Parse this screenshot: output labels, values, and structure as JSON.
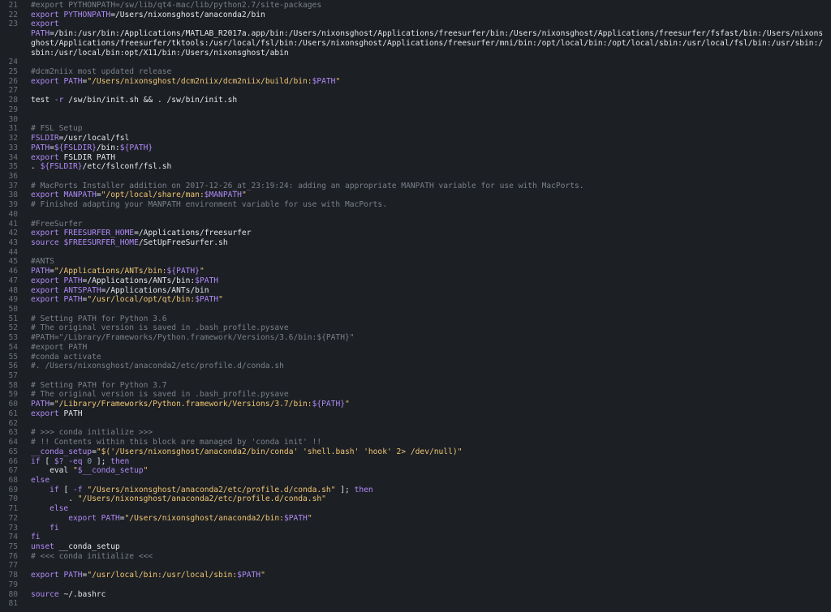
{
  "colors": {
    "background": "#1c1f24",
    "line_number": "#6b717a",
    "comment": "#7b8089",
    "keyword": "#b08bf7",
    "string": "#f0c674",
    "text": "#e4e6ea"
  },
  "lines": [
    {
      "n": "21",
      "tokens": [
        {
          "t": "cm",
          "v": "#export PYTHONPATH=/sw/lib/qt4-mac/lib/python2.7/site-packages"
        }
      ]
    },
    {
      "n": "22",
      "tokens": [
        {
          "t": "kw",
          "v": "export "
        },
        {
          "t": "vr",
          "v": "PYTHONPATH"
        },
        {
          "t": "tx",
          "v": "=/Users/nixonsghost/anaconda2/bin"
        }
      ]
    },
    {
      "n": "23",
      "tokens": [
        {
          "t": "kw",
          "v": "export\n"
        },
        {
          "t": "vr",
          "v": "PATH"
        },
        {
          "t": "tx",
          "v": "=/bin:/usr/bin:/Applications/MATLAB_R2017a.app/bin:/Users/nixonsghost/Applications/freesurfer/bin:/Users/nixonsghost/Applications/freesurfer/fsfast/bin:/Users/nixonsghost/Applications/freesurfer/tktools:/usr/local/fsl/bin:/Users/nixonsghost/Applications/freesurfer/mni/bin:/opt/local/bin:/opt/local/sbin:/usr/local/fsl/bin:/usr/sbin:/sbin:/usr/local/bin:opt/X11/bin:/Users/nixonsghost/abin"
        }
      ]
    },
    {
      "n": "24",
      "tokens": []
    },
    {
      "n": "25",
      "tokens": [
        {
          "t": "cm",
          "v": "#dcm2niix most updated release"
        }
      ]
    },
    {
      "n": "26",
      "tokens": [
        {
          "t": "kw",
          "v": "export "
        },
        {
          "t": "vr",
          "v": "PATH"
        },
        {
          "t": "tx",
          "v": "="
        },
        {
          "t": "st",
          "v": "\"/Users/nixonsghost/dcm2niix/dcm2niix/build/bin:"
        },
        {
          "t": "vr",
          "v": "$PATH"
        },
        {
          "t": "st",
          "v": "\""
        }
      ]
    },
    {
      "n": "27",
      "tokens": []
    },
    {
      "n": "28",
      "tokens": [
        {
          "t": "tx",
          "v": "test "
        },
        {
          "t": "kw",
          "v": "-r"
        },
        {
          "t": "tx",
          "v": " /sw/bin/init.sh && . /sw/bin/init.sh"
        }
      ]
    },
    {
      "n": "29",
      "tokens": []
    },
    {
      "n": "30",
      "tokens": []
    },
    {
      "n": "31",
      "tokens": [
        {
          "t": "cm",
          "v": "# FSL Setup"
        }
      ]
    },
    {
      "n": "32",
      "tokens": [
        {
          "t": "vr",
          "v": "FSLDIR"
        },
        {
          "t": "tx",
          "v": "=/usr/local/fsl"
        }
      ]
    },
    {
      "n": "33",
      "tokens": [
        {
          "t": "vr",
          "v": "PATH"
        },
        {
          "t": "tx",
          "v": "="
        },
        {
          "t": "vr",
          "v": "${FSLDIR}"
        },
        {
          "t": "tx",
          "v": "/bin:"
        },
        {
          "t": "vr",
          "v": "${PATH}"
        }
      ]
    },
    {
      "n": "34",
      "tokens": [
        {
          "t": "kw",
          "v": "export "
        },
        {
          "t": "tx",
          "v": "FSLDIR PATH"
        }
      ]
    },
    {
      "n": "35",
      "tokens": [
        {
          "t": "tx",
          "v": ". "
        },
        {
          "t": "vr",
          "v": "${FSLDIR}"
        },
        {
          "t": "tx",
          "v": "/etc/fslconf/fsl.sh"
        }
      ]
    },
    {
      "n": "36",
      "tokens": []
    },
    {
      "n": "37",
      "tokens": [
        {
          "t": "cm",
          "v": "# MacPorts Installer addition on 2017-12-26_at_23:19:24: adding an appropriate MANPATH variable for use with MacPorts."
        }
      ]
    },
    {
      "n": "38",
      "tokens": [
        {
          "t": "kw",
          "v": "export "
        },
        {
          "t": "vr",
          "v": "MANPATH"
        },
        {
          "t": "tx",
          "v": "="
        },
        {
          "t": "st",
          "v": "\"/opt/local/share/man:"
        },
        {
          "t": "vr",
          "v": "$MANPATH"
        },
        {
          "t": "st",
          "v": "\""
        }
      ]
    },
    {
      "n": "39",
      "tokens": [
        {
          "t": "cm",
          "v": "# Finished adapting your MANPATH environment variable for use with MacPorts."
        }
      ]
    },
    {
      "n": "40",
      "tokens": []
    },
    {
      "n": "41",
      "tokens": [
        {
          "t": "cm",
          "v": "#FreeSurfer"
        }
      ]
    },
    {
      "n": "42",
      "tokens": [
        {
          "t": "kw",
          "v": "export "
        },
        {
          "t": "vr",
          "v": "FREESURFER_HOME"
        },
        {
          "t": "tx",
          "v": "=/Applications/freesurfer"
        }
      ]
    },
    {
      "n": "43",
      "tokens": [
        {
          "t": "kw",
          "v": "source "
        },
        {
          "t": "vr",
          "v": "$FREESURFER_HOME"
        },
        {
          "t": "tx",
          "v": "/SetUpFreeSurfer.sh"
        }
      ]
    },
    {
      "n": "44",
      "tokens": []
    },
    {
      "n": "45",
      "tokens": [
        {
          "t": "cm",
          "v": "#ANTS"
        }
      ]
    },
    {
      "n": "46",
      "tokens": [
        {
          "t": "vr",
          "v": "PATH"
        },
        {
          "t": "tx",
          "v": "="
        },
        {
          "t": "st",
          "v": "\"/Applications/ANTs/bin:"
        },
        {
          "t": "vr",
          "v": "${PATH}"
        },
        {
          "t": "st",
          "v": "\""
        }
      ]
    },
    {
      "n": "47",
      "tokens": [
        {
          "t": "kw",
          "v": "export "
        },
        {
          "t": "vr",
          "v": "PATH"
        },
        {
          "t": "tx",
          "v": "=/Applications/ANTs/bin:"
        },
        {
          "t": "vr",
          "v": "$PATH"
        }
      ]
    },
    {
      "n": "48",
      "tokens": [
        {
          "t": "kw",
          "v": "export "
        },
        {
          "t": "vr",
          "v": "ANTSPATH"
        },
        {
          "t": "tx",
          "v": "=/Applications/ANTs/bin"
        }
      ]
    },
    {
      "n": "49",
      "tokens": [
        {
          "t": "kw",
          "v": "export "
        },
        {
          "t": "vr",
          "v": "PATH"
        },
        {
          "t": "tx",
          "v": "="
        },
        {
          "t": "st",
          "v": "\"/usr/local/opt/qt/bin:"
        },
        {
          "t": "vr",
          "v": "$PATH"
        },
        {
          "t": "st",
          "v": "\""
        }
      ]
    },
    {
      "n": "50",
      "tokens": []
    },
    {
      "n": "51",
      "tokens": [
        {
          "t": "cm",
          "v": "# Setting PATH for Python 3.6"
        }
      ]
    },
    {
      "n": "52",
      "tokens": [
        {
          "t": "cm",
          "v": "# The original version is saved in .bash_profile.pysave"
        }
      ]
    },
    {
      "n": "53",
      "tokens": [
        {
          "t": "cm",
          "v": "#PATH=\"/Library/Frameworks/Python.framework/Versions/3.6/bin:${PATH}\""
        }
      ]
    },
    {
      "n": "54",
      "tokens": [
        {
          "t": "cm",
          "v": "#export PATH"
        }
      ]
    },
    {
      "n": "55",
      "tokens": [
        {
          "t": "cm",
          "v": "#conda activate"
        }
      ]
    },
    {
      "n": "56",
      "tokens": [
        {
          "t": "cm",
          "v": "#. /Users/nixonsghost/anaconda2/etc/profile.d/conda.sh"
        }
      ]
    },
    {
      "n": "57",
      "tokens": []
    },
    {
      "n": "58",
      "tokens": [
        {
          "t": "cm",
          "v": "# Setting PATH for Python 3.7"
        }
      ]
    },
    {
      "n": "59",
      "tokens": [
        {
          "t": "cm",
          "v": "# The original version is saved in .bash_profile.pysave"
        }
      ]
    },
    {
      "n": "60",
      "tokens": [
        {
          "t": "vr",
          "v": "PATH"
        },
        {
          "t": "tx",
          "v": "="
        },
        {
          "t": "st",
          "v": "\"/Library/Frameworks/Python.framework/Versions/3.7/bin:"
        },
        {
          "t": "vr",
          "v": "${PATH}"
        },
        {
          "t": "st",
          "v": "\""
        }
      ]
    },
    {
      "n": "61",
      "tokens": [
        {
          "t": "kw",
          "v": "export "
        },
        {
          "t": "tx",
          "v": "PATH"
        }
      ]
    },
    {
      "n": "62",
      "tokens": []
    },
    {
      "n": "63",
      "tokens": [
        {
          "t": "cm",
          "v": "# >>> conda initialize >>>"
        }
      ]
    },
    {
      "n": "64",
      "tokens": [
        {
          "t": "cm",
          "v": "# !! Contents within this block are managed by 'conda init' !!"
        }
      ]
    },
    {
      "n": "65",
      "tokens": [
        {
          "t": "vr",
          "v": "__conda_setup"
        },
        {
          "t": "tx",
          "v": "="
        },
        {
          "t": "st",
          "v": "\"$('/Users/nixonsghost/anaconda2/bin/conda' 'shell.bash' 'hook' 2> /dev/null)\""
        }
      ]
    },
    {
      "n": "66",
      "tokens": [
        {
          "t": "kw",
          "v": "if"
        },
        {
          "t": "tx",
          "v": " [ "
        },
        {
          "t": "vr",
          "v": "$?"
        },
        {
          "t": "tx",
          "v": " "
        },
        {
          "t": "kw",
          "v": "-eq"
        },
        {
          "t": "tx",
          "v": " "
        },
        {
          "t": "nu",
          "v": "0"
        },
        {
          "t": "tx",
          "v": " ]; "
        },
        {
          "t": "kw",
          "v": "then"
        }
      ]
    },
    {
      "n": "67",
      "tokens": [
        {
          "t": "tx",
          "v": "    eval "
        },
        {
          "t": "st",
          "v": "\""
        },
        {
          "t": "vr",
          "v": "$__conda_setup"
        },
        {
          "t": "st",
          "v": "\""
        }
      ]
    },
    {
      "n": "68",
      "tokens": [
        {
          "t": "kw",
          "v": "else"
        }
      ]
    },
    {
      "n": "69",
      "tokens": [
        {
          "t": "tx",
          "v": "    "
        },
        {
          "t": "kw",
          "v": "if"
        },
        {
          "t": "tx",
          "v": " [ "
        },
        {
          "t": "kw",
          "v": "-f"
        },
        {
          "t": "tx",
          "v": " "
        },
        {
          "t": "st",
          "v": "\"/Users/nixonsghost/anaconda2/etc/profile.d/conda.sh\""
        },
        {
          "t": "tx",
          "v": " ]; "
        },
        {
          "t": "kw",
          "v": "then"
        }
      ]
    },
    {
      "n": "70",
      "tokens": [
        {
          "t": "tx",
          "v": "        . "
        },
        {
          "t": "st",
          "v": "\"/Users/nixonsghost/anaconda2/etc/profile.d/conda.sh\""
        }
      ]
    },
    {
      "n": "71",
      "tokens": [
        {
          "t": "kw",
          "v": "    else"
        }
      ]
    },
    {
      "n": "72",
      "tokens": [
        {
          "t": "tx",
          "v": "        "
        },
        {
          "t": "kw",
          "v": "export "
        },
        {
          "t": "vr",
          "v": "PATH"
        },
        {
          "t": "tx",
          "v": "="
        },
        {
          "t": "st",
          "v": "\"/Users/nixonsghost/anaconda2/bin:"
        },
        {
          "t": "vr",
          "v": "$PATH"
        },
        {
          "t": "st",
          "v": "\""
        }
      ]
    },
    {
      "n": "73",
      "tokens": [
        {
          "t": "kw",
          "v": "    fi"
        }
      ]
    },
    {
      "n": "74",
      "tokens": [
        {
          "t": "kw",
          "v": "fi"
        }
      ]
    },
    {
      "n": "75",
      "tokens": [
        {
          "t": "kw",
          "v": "unset "
        },
        {
          "t": "tx",
          "v": "__conda_setup"
        }
      ]
    },
    {
      "n": "76",
      "tokens": [
        {
          "t": "cm",
          "v": "# <<< conda initialize <<<"
        }
      ]
    },
    {
      "n": "77",
      "tokens": []
    },
    {
      "n": "78",
      "tokens": [
        {
          "t": "kw",
          "v": "export "
        },
        {
          "t": "vr",
          "v": "PATH"
        },
        {
          "t": "tx",
          "v": "="
        },
        {
          "t": "st",
          "v": "\"/usr/local/bin:/usr/local/sbin:"
        },
        {
          "t": "vr",
          "v": "$PATH"
        },
        {
          "t": "st",
          "v": "\""
        }
      ]
    },
    {
      "n": "79",
      "tokens": []
    },
    {
      "n": "80",
      "tokens": [
        {
          "t": "kw",
          "v": "source "
        },
        {
          "t": "tx",
          "v": "~/.bashrc"
        }
      ]
    },
    {
      "n": "81",
      "tokens": []
    }
  ]
}
